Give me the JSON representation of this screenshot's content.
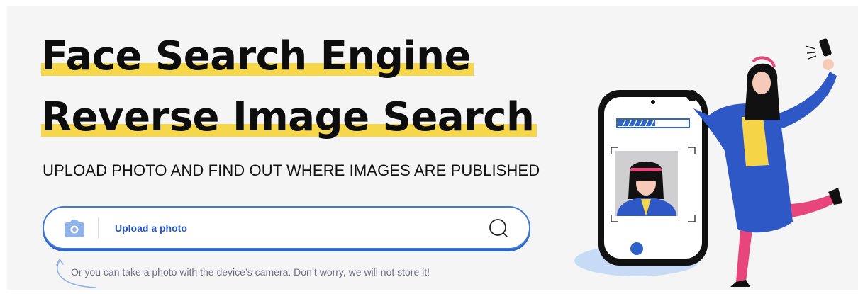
{
  "hero": {
    "title_line1": "Face Search Engine",
    "title_line2": "Reverse Image Search",
    "subtitle": "UPLOAD PHOTO AND FIND OUT WHERE IMAGES ARE PUBLISHED"
  },
  "search": {
    "upload_label": "Upload a photo",
    "hint": "Or you can take a photo with the device’s camera. Don’t worry, we will not store it!"
  },
  "colors": {
    "accent": "#3e7ad7",
    "link": "#2457c5",
    "highlight": "#f6d74a",
    "camera_icon": "#8fb2ea"
  },
  "icons": {
    "camera": "camera-icon",
    "search": "search-icon",
    "hint_arrow": "curved-arrow-icon"
  }
}
